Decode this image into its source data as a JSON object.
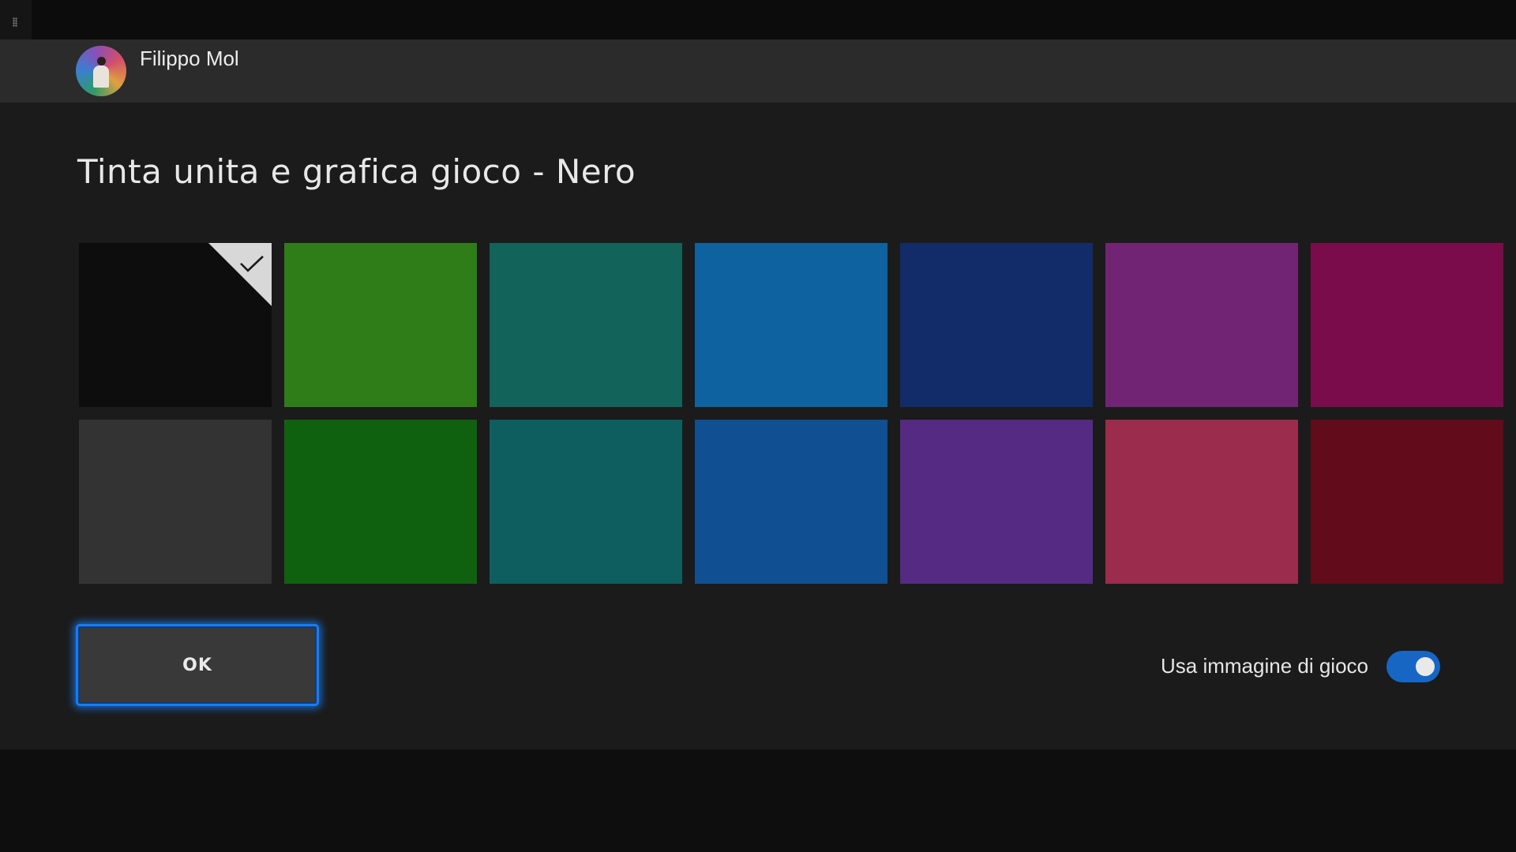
{
  "header": {
    "username": "Filippo Mol"
  },
  "page": {
    "title": "Tinta unita e grafica gioco - Nero"
  },
  "swatches": [
    {
      "color": "#0d0d0d",
      "selected": true
    },
    {
      "color": "#2e7d18",
      "selected": false
    },
    {
      "color": "#126359",
      "selected": false
    },
    {
      "color": "#0f62a0",
      "selected": false
    },
    {
      "color": "#122c69",
      "selected": false
    },
    {
      "color": "#722474",
      "selected": false
    },
    {
      "color": "#7a0c4c",
      "selected": false
    },
    {
      "color": "#333333",
      "selected": false
    },
    {
      "color": "#10610f",
      "selected": false
    },
    {
      "color": "#0f5e5f",
      "selected": false
    },
    {
      "color": "#104f91",
      "selected": false
    },
    {
      "color": "#542a82",
      "selected": false
    },
    {
      "color": "#9b2c4d",
      "selected": false
    },
    {
      "color": "#620b1b",
      "selected": false
    }
  ],
  "actions": {
    "ok_label": "OK"
  },
  "toggle": {
    "label": "Usa immagine di gioco",
    "on": true,
    "accent": "#1766c4"
  },
  "colors": {
    "focus_ring": "#1a7cf0",
    "panel": "#1b1b1b",
    "header": "#2b2b2b"
  }
}
